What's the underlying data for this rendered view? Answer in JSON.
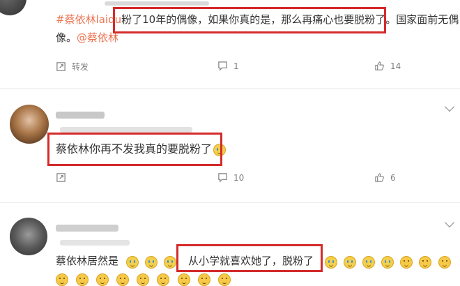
{
  "comment1": {
    "hashtag": "#蔡依林laidu",
    "text_line1": "粉了10年的偶像，如果你真的是，那么再痛心也要脱粉了。国家面前无偶",
    "text_line2_pre": "像。",
    "mention": "@蔡依林",
    "repost_label": "转发",
    "comment_count": "1",
    "like_count": "14"
  },
  "comment2": {
    "text": "蔡依林你再不发我真的要脱粉了",
    "comment_count": "10",
    "like_count": "6"
  },
  "comment3": {
    "text_pre": "蔡依林居然是",
    "text_boxed": "从小学就喜欢她了，脱粉了"
  },
  "colors": {
    "highlight_box": "#d42b2b",
    "link": "#eb7350"
  },
  "icons": [
    "repost-icon",
    "comment-icon",
    "like-icon",
    "chevron-down-icon"
  ]
}
